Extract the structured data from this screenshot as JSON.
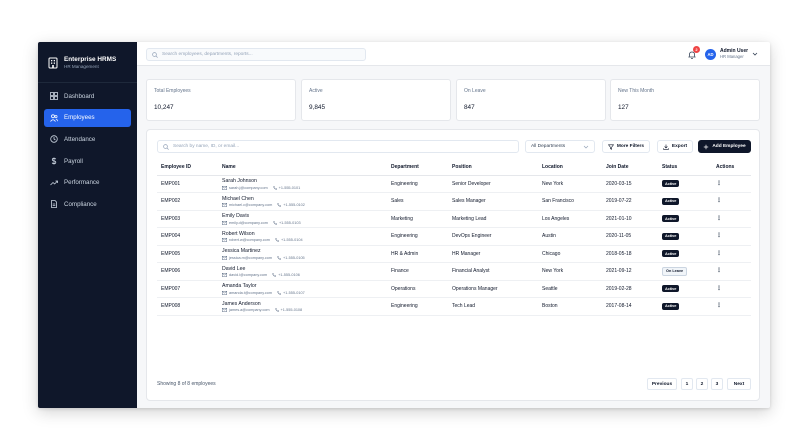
{
  "sidebar": {
    "brand_title": "Enterprise HRMS",
    "brand_subtitle": "HR Management",
    "items": [
      {
        "label": "Dashboard",
        "icon": "dashboard-grid-icon",
        "active": false
      },
      {
        "label": "Employees",
        "icon": "users-icon",
        "active": true
      },
      {
        "label": "Attendance",
        "icon": "clock-icon",
        "active": false
      },
      {
        "label": "Payroll",
        "icon": "dollar-icon",
        "active": false
      },
      {
        "label": "Performance",
        "icon": "trend-up-icon",
        "active": false
      },
      {
        "label": "Compliance",
        "icon": "document-icon",
        "active": false
      }
    ]
  },
  "topbar": {
    "search_placeholder": "Search employees, departments, reports...",
    "notification_count": "2",
    "user_initials": "AD",
    "user_name": "Admin User",
    "user_role": "HR Manager"
  },
  "stats": [
    {
      "label": "Total Employees",
      "value": "10,247"
    },
    {
      "label": "Active",
      "value": "9,845"
    },
    {
      "label": "On Leave",
      "value": "847"
    },
    {
      "label": "New This Month",
      "value": "127"
    }
  ],
  "filters": {
    "search_placeholder": "Search by name, ID, or email...",
    "department_selected": "All Departments",
    "more_filters_label": "More Filters",
    "export_label": "Export",
    "add_employee_label": "Add Employee"
  },
  "table": {
    "headers": {
      "id": "Employee ID",
      "name": "Name",
      "department": "Department",
      "position": "Position",
      "location": "Location",
      "join_date": "Join Date",
      "status": "Status",
      "actions": "Actions"
    },
    "rows": [
      {
        "id": "EMP001",
        "name": "Sarah Johnson",
        "email": "sarah.j@company.com",
        "phone": "+1-555-0101",
        "department": "Engineering",
        "position": "Senior Developer",
        "location": "New York",
        "join_date": "2020-03-15",
        "status": "Active"
      },
      {
        "id": "EMP002",
        "name": "Michael Chen",
        "email": "michael.c@company.com",
        "phone": "+1-555-0102",
        "department": "Sales",
        "position": "Sales Manager",
        "location": "San Francisco",
        "join_date": "2019-07-22",
        "status": "Active"
      },
      {
        "id": "EMP003",
        "name": "Emily Davis",
        "email": "emily.d@company.com",
        "phone": "+1-555-0103",
        "department": "Marketing",
        "position": "Marketing Lead",
        "location": "Los Angeles",
        "join_date": "2021-01-10",
        "status": "Active"
      },
      {
        "id": "EMP004",
        "name": "Robert Wilson",
        "email": "robert.w@company.com",
        "phone": "+1-555-0104",
        "department": "Engineering",
        "position": "DevOps Engineer",
        "location": "Austin",
        "join_date": "2020-11-05",
        "status": "Active"
      },
      {
        "id": "EMP005",
        "name": "Jessica Martinez",
        "email": "jessica.m@company.com",
        "phone": "+1-555-0105",
        "department": "HR & Admin",
        "position": "HR Manager",
        "location": "Chicago",
        "join_date": "2018-05-18",
        "status": "Active"
      },
      {
        "id": "EMP006",
        "name": "David Lee",
        "email": "david.l@company.com",
        "phone": "+1-555-0106",
        "department": "Finance",
        "position": "Financial Analyst",
        "location": "New York",
        "join_date": "2021-09-12",
        "status": "On Leave"
      },
      {
        "id": "EMP007",
        "name": "Amanda Taylor",
        "email": "amanda.t@company.com",
        "phone": "+1-555-0107",
        "department": "Operations",
        "position": "Operations Manager",
        "location": "Seattle",
        "join_date": "2019-02-28",
        "status": "Active"
      },
      {
        "id": "EMP008",
        "name": "James Anderson",
        "email": "james.a@company.com",
        "phone": "+1-555-0108",
        "department": "Engineering",
        "position": "Tech Lead",
        "location": "Boston",
        "join_date": "2017-08-14",
        "status": "Active"
      }
    ]
  },
  "pagination": {
    "summary": "Showing 8 of 8 employees",
    "previous_label": "Previous",
    "pages": [
      "1",
      "2",
      "3"
    ],
    "next_label": "Next"
  },
  "colors": {
    "sidebar_bg": "#0f172a",
    "accent": "#2563eb",
    "notification": "#ef4444"
  }
}
